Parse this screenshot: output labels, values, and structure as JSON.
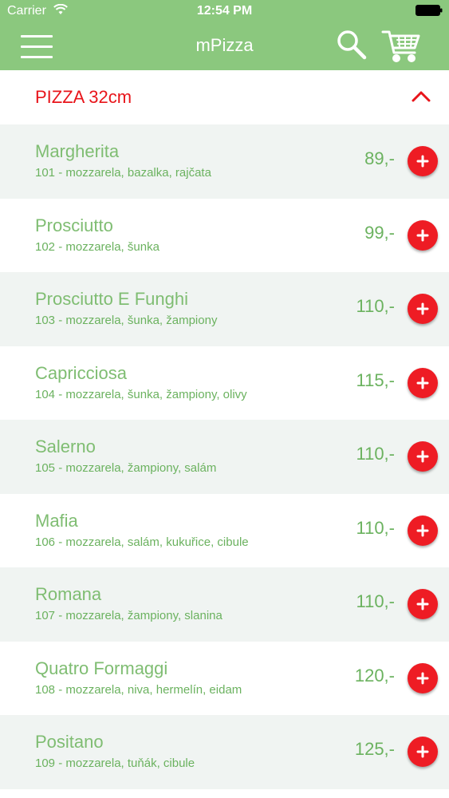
{
  "status_bar": {
    "carrier": "Carrier",
    "time": "12:54 PM"
  },
  "nav": {
    "title": "mPizza",
    "icons": {
      "menu": "hamburger-menu-icon",
      "search": "search-icon",
      "cart": "shopping-cart-icon"
    }
  },
  "category": {
    "title": "PIZZA 32cm",
    "expanded": true
  },
  "colors": {
    "header_green": "#8bc87e",
    "text_green": "#6bb25f",
    "category_red": "#e8141a",
    "add_button_red": "#ee1c24",
    "row_alt_bg": "#f0f4f2"
  },
  "items": [
    {
      "name": "Margherita",
      "description": "101 - mozzarela, bazalka, rajčata",
      "price": "89,-"
    },
    {
      "name": "Prosciutto",
      "description": "102 - mozzarela, šunka",
      "price": "99,-"
    },
    {
      "name": "Prosciutto E Funghi",
      "description": "103 - mozzarela, šunka, žampiony",
      "price": "110,-"
    },
    {
      "name": "Capricciosa",
      "description": "104 - mozzarela, šunka, žampiony, olivy",
      "price": "115,-"
    },
    {
      "name": "Salerno",
      "description": "105 - mozzarela, žampiony, salám",
      "price": "110,-"
    },
    {
      "name": "Mafia",
      "description": "106 - mozzarela, salám, kukuřice, cibule",
      "price": "110,-"
    },
    {
      "name": "Romana",
      "description": "107 - mozzarela, žampiony, slanina",
      "price": "110,-"
    },
    {
      "name": "Quatro Formaggi",
      "description": "108 - mozzarela, niva, hermelín, eidam",
      "price": "120,-"
    },
    {
      "name": "Positano",
      "description": "109 - mozzarela, tuňák, cibule",
      "price": "125,-"
    }
  ]
}
